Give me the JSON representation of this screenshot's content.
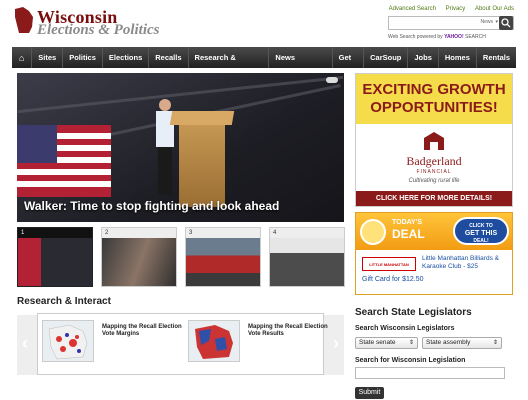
{
  "logo": {
    "line1": "Wisconsin",
    "line2": "Elections & Politics"
  },
  "toplinks": [
    "Advanced Search",
    "Privacy",
    "About Our Ads"
  ],
  "search": {
    "placeholder": "",
    "scope": "News",
    "powered": "Web Search powered by",
    "yahoo": "YAHOO!",
    "search_word": "SEARCH"
  },
  "nav": {
    "items": [
      "Sites",
      "Politics",
      "Elections",
      "Recalls",
      "Research & Interact",
      "News Partners",
      "Get It",
      "CarSoup",
      "Jobs",
      "Homes",
      "Rentals"
    ]
  },
  "hero": {
    "caption": "Walker: Time to stop fighting and look ahead"
  },
  "thumbs": [
    "1",
    "2",
    "3",
    "4"
  ],
  "research": {
    "title": "Research & Interact",
    "items": [
      {
        "caption": "Mapping the Recall Election Vote Margins"
      },
      {
        "caption": "Mapping the Recall Election Vote Results"
      }
    ]
  },
  "ad_badgerland": {
    "headline": "EXCITING GROWTH OPPORTUNITIES!",
    "brand": "Badgerland",
    "brand_sub": "FINANCIAL",
    "tagline": "Cultivating rural life",
    "cta": "CLICK HERE FOR MORE DETAILS!"
  },
  "ad_deal": {
    "today": "TODAY'S",
    "deal": "DEAL",
    "click_top": "CLICK TO",
    "click_mid": "GET THIS",
    "click_bot": "DEAL!",
    "merchant_logo": "LITTLE MANHATTAN",
    "description": "Little Manhattan Billiards & Karaoke Club - $25",
    "price": "Gift Card for $12.50"
  },
  "legislators": {
    "title": "Search State Legislators",
    "label1": "Search Wisconsin Legislators",
    "select_senate": "State senate",
    "select_assembly": "State assembly",
    "label2": "Search for Wisconsin Legislation",
    "submit": "Submit"
  },
  "colors": {
    "nav_bg": "#2a2a2a",
    "brand_red": "#8b1a1a",
    "ad_yellow": "#f4dc4a",
    "link_green": "#4f7a15"
  }
}
